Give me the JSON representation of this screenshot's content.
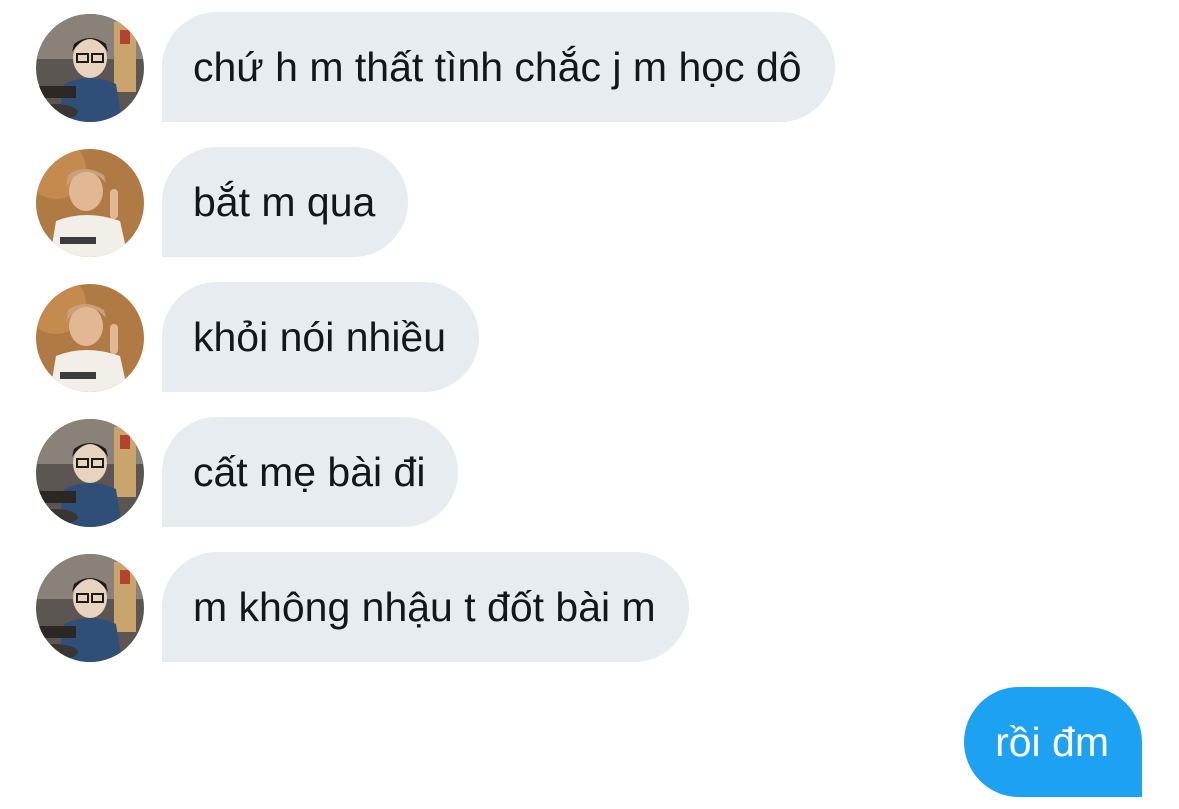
{
  "conversation": {
    "messages": [
      {
        "sender": "other-user-a",
        "avatar_icon": "avatar-glasses-icon",
        "text": "chứ h m thất tình chắc j m học dô"
      },
      {
        "sender": "other-user-b",
        "avatar_icon": "avatar-white-shirt-icon",
        "text": "bắt m qua"
      },
      {
        "sender": "other-user-b",
        "avatar_icon": "avatar-white-shirt-icon",
        "text": "khỏi nói nhiều"
      },
      {
        "sender": "other-user-a",
        "avatar_icon": "avatar-glasses-icon",
        "text": "cất mẹ bài đi"
      },
      {
        "sender": "other-user-a",
        "avatar_icon": "avatar-glasses-icon",
        "text": "m không nhậu t đốt bài m"
      },
      {
        "sender": "me",
        "text": "rồi đm"
      }
    ]
  },
  "colors": {
    "incoming_bubble": "#e6ecf0",
    "incoming_text": "#14171a",
    "outgoing_bubble": "#1da1f2",
    "outgoing_text": "#ffffff",
    "background": "#ffffff"
  }
}
